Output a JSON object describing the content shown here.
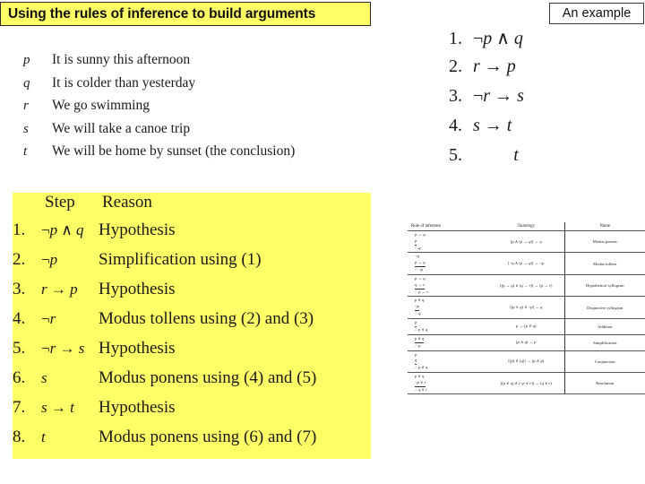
{
  "title_banner": {
    "text": "Using the rules of inference to build arguments"
  },
  "example_box": {
    "label": "An example"
  },
  "propositions": [
    {
      "symbol": "p",
      "text": "It is sunny this afternoon"
    },
    {
      "symbol": "q",
      "text": "It is colder than yesterday"
    },
    {
      "symbol": "r",
      "text": "We go swimming"
    },
    {
      "symbol": "s",
      "text": "We will take a canoe trip"
    },
    {
      "symbol": "t",
      "text": "We will be home by sunset (the conclusion)"
    }
  ],
  "premises": [
    {
      "num": "1.",
      "expr": "¬p ∧ q"
    },
    {
      "num": "2.",
      "expr": "r → p"
    },
    {
      "num": "3.",
      "expr": "¬r → s"
    },
    {
      "num": "4.",
      "expr": "s → t"
    },
    {
      "num": "5.",
      "expr": "t"
    }
  ],
  "proof_table": {
    "headers": {
      "step": "Step",
      "reason": "Reason"
    },
    "rows": [
      {
        "num": "1.",
        "step": "¬p ∧ q",
        "reason": "Hypothesis"
      },
      {
        "num": "2.",
        "step": "¬p",
        "reason": "Simplification using (1)"
      },
      {
        "num": "3.",
        "step": "r → p",
        "reason": "Hypothesis"
      },
      {
        "num": "4.",
        "step": "¬r",
        "reason": "Modus tollens using (2) and (3)"
      },
      {
        "num": "5.",
        "step": "¬r → s",
        "reason": "Hypothesis"
      },
      {
        "num": "6.",
        "step": "s",
        "reason": "Modus ponens using (4) and (5)"
      },
      {
        "num": "7.",
        "step": "s → t",
        "reason": "Hypothesis"
      },
      {
        "num": "8.",
        "step": "t",
        "reason": "Modus ponens using (6) and (7)"
      }
    ]
  },
  "rules_table": {
    "headers": [
      "Rule of inference",
      "Tautology",
      "Name"
    ],
    "rows": [
      {
        "premise1": "p → q",
        "premise2": "p",
        "conclusion": "∴ q",
        "tautology": "[p ∧ (p → q)] → q",
        "name": "Modus ponens"
      },
      {
        "premise1": "¬q",
        "premise2": "p → q",
        "conclusion": "∴ ¬p",
        "tautology": "[¬q ∧ (p → q)] → ¬p",
        "name": "Modus tollens"
      },
      {
        "premise1": "p → q",
        "premise2": "q → r",
        "conclusion": "∴ p → r",
        "tautology": "[(p → q) ∧ (q → r)] → (p → r)",
        "name": "Hypothetical syllogism"
      },
      {
        "premise1": "p ∨ q",
        "premise2": "¬p",
        "conclusion": "∴ q",
        "tautology": "[(p ∨ q) ∧ ¬p] → q",
        "name": "Disjunctive syllogism"
      },
      {
        "premise1": "",
        "premise2": "p",
        "conclusion": "∴ p ∨ q",
        "tautology": "p → (p ∨ q)",
        "name": "Addition"
      },
      {
        "premise1": "",
        "premise2": "p ∧ q",
        "conclusion": "∴ p",
        "tautology": "(p ∧ q) → p",
        "name": "Simplification"
      },
      {
        "premise1": "p",
        "premise2": "q",
        "conclusion": "∴ p ∧ q",
        "tautology": "[(p) ∧ (q)] → (p ∧ q)",
        "name": "Conjunction"
      },
      {
        "premise1": "p ∨ q",
        "premise2": "¬p ∨ r",
        "conclusion": "∴ q ∨ r",
        "tautology": "[(p ∨ q) ∧ (¬p ∨ r)] → (q ∨ r)",
        "name": "Resolution"
      }
    ]
  },
  "colors": {
    "highlight": "#ffff66",
    "text": "#1a1a1a",
    "border": "#2b2b2b"
  }
}
